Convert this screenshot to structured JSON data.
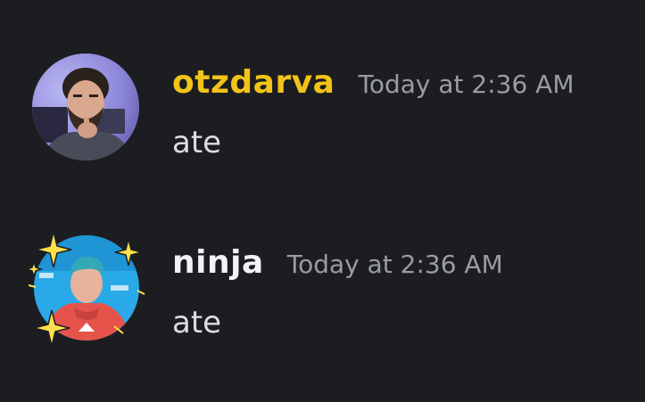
{
  "theme": {
    "background": "#1c1d21",
    "timestamp_color": "#9a9ca3",
    "text_color": "#dcdde1"
  },
  "messages": [
    {
      "username": "otzdarva",
      "username_color": "#f2c318",
      "timestamp": "Today at 2:36 AM",
      "content": "ate",
      "avatar": "user-photo-avatar"
    },
    {
      "username": "ninja",
      "username_color": "#f2f3f5",
      "timestamp": "Today at 2:36 AM",
      "content": "ate",
      "avatar": "user-photo-avatar-with-sparkle-frame"
    }
  ]
}
